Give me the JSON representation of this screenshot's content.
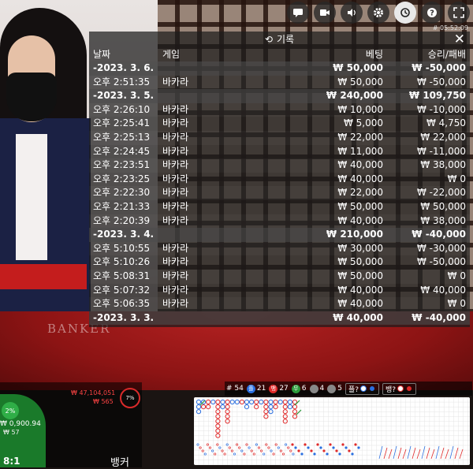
{
  "topbar": {
    "icons": [
      "chat-icon",
      "video-icon",
      "volume-icon",
      "gear-icon",
      "history-icon",
      "help-icon",
      "fullscreen-icon"
    ],
    "clock": "# 05:52:09"
  },
  "panel": {
    "title": "기록",
    "columns": {
      "date": "날짜",
      "game": "게임",
      "bet": "베팅",
      "result": "승리/패배"
    },
    "groups": [
      {
        "date": "-2023. 3. 6.",
        "bet": "₩ 50,000",
        "result": "₩ -50,000",
        "rows": [
          {
            "time": "오후 2:51:35",
            "game": "바카라",
            "bet": "₩ 50,000",
            "result": "₩ -50,000"
          }
        ]
      },
      {
        "date": "-2023. 3. 5.",
        "bet": "₩ 240,000",
        "result": "₩ 109,750",
        "rows": [
          {
            "time": "오후 2:26:10",
            "game": "바카라",
            "bet": "₩ 10,000",
            "result": "₩ -10,000"
          },
          {
            "time": "오후 2:25:41",
            "game": "바카라",
            "bet": "₩ 5,000",
            "result": "₩ 4,750"
          },
          {
            "time": "오후 2:25:13",
            "game": "바카라",
            "bet": "₩ 22,000",
            "result": "₩ 22,000"
          },
          {
            "time": "오후 2:24:45",
            "game": "바카라",
            "bet": "₩ 11,000",
            "result": "₩ -11,000"
          },
          {
            "time": "오후 2:23:51",
            "game": "바카라",
            "bet": "₩ 40,000",
            "result": "₩ 38,000"
          },
          {
            "time": "오후 2:23:25",
            "game": "바카라",
            "bet": "₩ 40,000",
            "result": "₩ 0"
          },
          {
            "time": "오후 2:22:30",
            "game": "바카라",
            "bet": "₩ 22,000",
            "result": "₩ -22,000"
          },
          {
            "time": "오후 2:21:33",
            "game": "바카라",
            "bet": "₩ 50,000",
            "result": "₩ 50,000"
          },
          {
            "time": "오후 2:20:39",
            "game": "바카라",
            "bet": "₩ 40,000",
            "result": "₩ 38,000"
          }
        ]
      },
      {
        "date": "-2023. 3. 4.",
        "bet": "₩ 210,000",
        "result": "₩ -40,000",
        "rows": [
          {
            "time": "오후 5:10:55",
            "game": "바카라",
            "bet": "₩ 30,000",
            "result": "₩ -30,000"
          },
          {
            "time": "오후 5:10:26",
            "game": "바카라",
            "bet": "₩ 50,000",
            "result": "₩ -50,000"
          },
          {
            "time": "오후 5:08:31",
            "game": "바카라",
            "bet": "₩ 50,000",
            "result": "₩ 0"
          },
          {
            "time": "오후 5:07:32",
            "game": "바카라",
            "bet": "₩ 40,000",
            "result": "₩ 40,000"
          },
          {
            "time": "오후 5:06:35",
            "game": "바카라",
            "bet": "₩ 40,000",
            "result": "₩ 0"
          }
        ]
      },
      {
        "date": "-2023. 3. 3.",
        "bet": "₩ 40,000",
        "result": "₩ -40,000",
        "rows": []
      }
    ]
  },
  "table_text": {
    "banker": "BANKER"
  },
  "bottom_left": {
    "chip": "2%",
    "amount": "₩ 0,900.94",
    "amount2": "₩ 57",
    "red_amount": "₩ 47,104,051",
    "red_amount2": "₩ 565",
    "timer": "7%",
    "ratio": "8:1",
    "banker_label": "뱅커"
  },
  "stats": {
    "round": "# 54",
    "player_count": "21",
    "banker_count": "27",
    "tie_count": "6",
    "player_pair": "4",
    "banker_pair": "5",
    "player_pred": "플?",
    "banker_pred": "뱅?",
    "player_symbol": "플",
    "banker_symbol": "뱅",
    "tie_symbol": "무",
    "colors": {
      "player": "#2a6fe0",
      "banker": "#e02a2a",
      "tie": "#2a9a3a"
    }
  }
}
